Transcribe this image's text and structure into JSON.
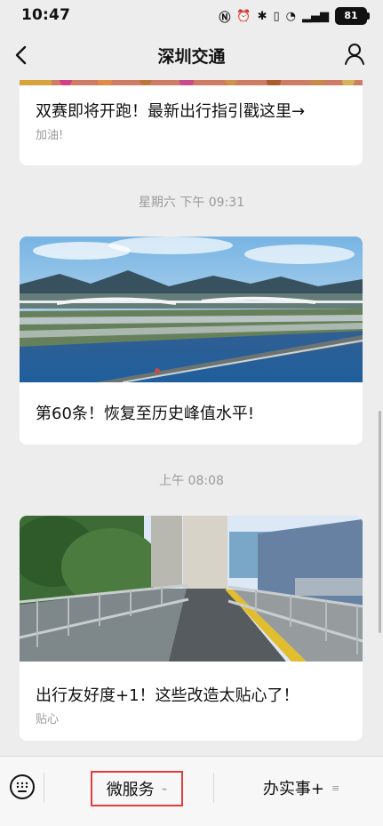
{
  "status_bar": {
    "time": "10:47",
    "battery": "81",
    "icons": [
      "nfc-icon",
      "alarm-icon",
      "bluetooth-icon",
      "vibrate-icon",
      "wifi-icon",
      "signal-icon",
      "battery-icon"
    ]
  },
  "header": {
    "title": "深圳交通"
  },
  "articles": [
    {
      "title": "双赛即将开跑！最新出行指引戳这里→",
      "subtitle": "加油!"
    },
    {
      "timestamp": "星期六 下午 09:31",
      "title": "第60条！恢复至历史峰值水平!"
    },
    {
      "timestamp": "上午 08:08",
      "title": "出行友好度+1！这些改造太贴心了！",
      "subtitle": "贴心"
    }
  ],
  "bottom_menu": {
    "service_label": "微服务",
    "office_label": "办实事+"
  },
  "colors": {
    "background": "#ededed",
    "highlight": "#e33b3b"
  }
}
